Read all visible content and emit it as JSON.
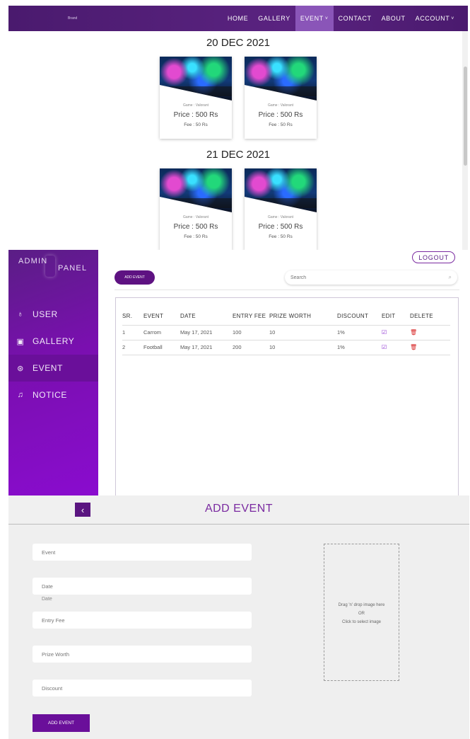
{
  "site": {
    "brand": "Brand",
    "nav": [
      {
        "label": "HOME",
        "caret": ""
      },
      {
        "label": "GALLERY",
        "caret": ""
      },
      {
        "label": "EVENT",
        "caret": "˅"
      },
      {
        "label": "CONTACT",
        "caret": ""
      },
      {
        "label": "ABOUT",
        "caret": ""
      },
      {
        "label": "ACCOUNT",
        "caret": "˅"
      }
    ],
    "active_nav": "EVENT",
    "days": [
      {
        "title": "20 DEC 2021",
        "cards": [
          {
            "game": "Game : Valorant",
            "price": "Price : 500 Rs",
            "fee": "Fee : 50 Rs"
          },
          {
            "game": "Game : Valorant",
            "price": "Price : 500 Rs",
            "fee": "Fee : 50 Rs"
          }
        ]
      },
      {
        "title": "21 DEC 2021",
        "cards": [
          {
            "game": "Game : Valorant",
            "price": "Price : 500 Rs",
            "fee": "Fee : 50 Rs"
          },
          {
            "game": "Game : Valorant",
            "price": "Price : 500 Rs",
            "fee": "Fee : 50 Rs"
          }
        ]
      }
    ]
  },
  "admin": {
    "title_1": "ADMIN",
    "title_2": "PANEL",
    "menu": [
      {
        "label": "USER",
        "icon": "users-icon",
        "glyph": "♁"
      },
      {
        "label": "GALLERY",
        "icon": "gallery-icon",
        "glyph": "▣"
      },
      {
        "label": "EVENT",
        "icon": "event-icon",
        "glyph": "⊛"
      },
      {
        "label": "NOTICE",
        "icon": "bell-icon",
        "glyph": "♫"
      }
    ],
    "active_menu": "EVENT",
    "logout_label": "LOGOUT",
    "add_event_label": "ADD EVENT",
    "search_placeholder": "Search",
    "table": {
      "headers": [
        "SR.",
        "EVENT",
        "DATE",
        "ENTRY FEE",
        "PRIZE WORTH",
        "DISCOUNT",
        "EDIT",
        "DELETE"
      ],
      "rows": [
        [
          "1",
          "Carrom",
          "May 17, 2021",
          "100",
          "10",
          "1%"
        ],
        [
          "2",
          "Football",
          "May 17, 2021",
          "200",
          "10",
          "1%"
        ]
      ]
    },
    "colors": {
      "sidebar": "#7a0fb0",
      "accent": "#5e1282",
      "delete": "#d62020"
    }
  },
  "form": {
    "title": "ADD EVENT",
    "back_glyph": "‹",
    "fields": {
      "event": "Event",
      "date": "Date",
      "date_label": "Date",
      "entry_fee": "Entry Fee",
      "prize_worth": "Prize Worth",
      "discount": "Discount"
    },
    "dropzone": {
      "line1": "Drag 'n' drop image here",
      "line2": "OR",
      "line3": "Click to select image"
    },
    "submit_label": "ADD EVENT"
  }
}
